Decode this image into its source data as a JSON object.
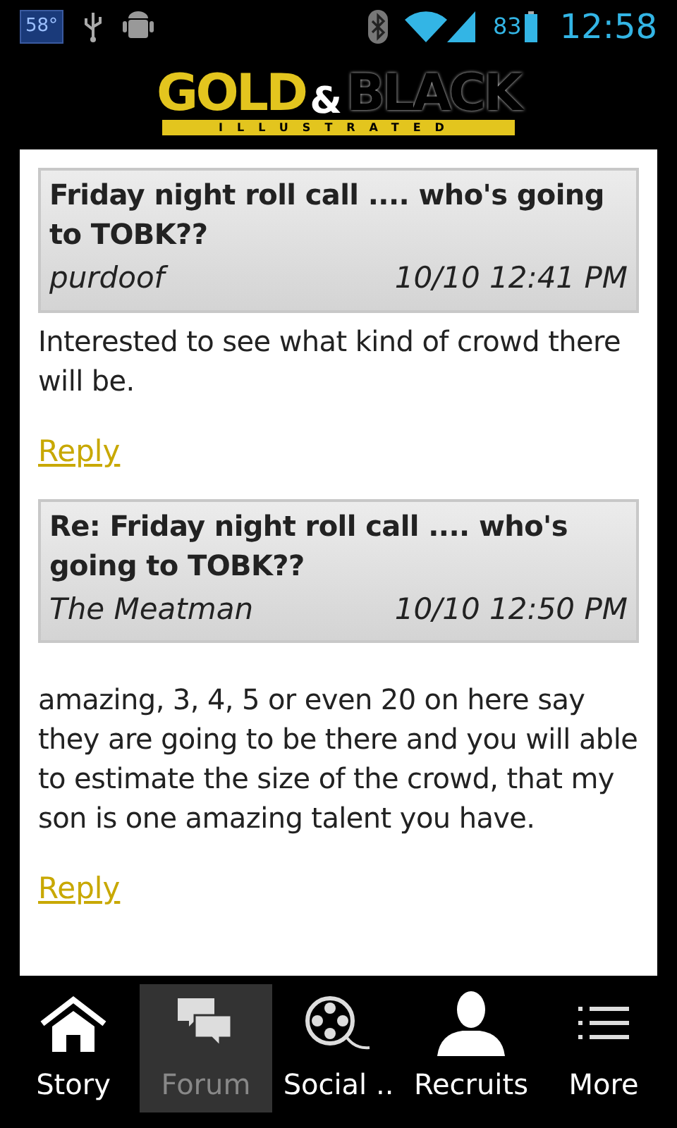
{
  "status_bar": {
    "temperature": "58°",
    "battery": "83",
    "time": "12:58"
  },
  "logo": {
    "title_left": "GOLD",
    "ampersand": "&",
    "title_right": "BLACK",
    "subtitle": "ILLUSTRATED"
  },
  "posts": [
    {
      "title": "Friday night roll call .... who's going to TOBK??",
      "author": "purdoof",
      "date": "10/10 12:41 PM",
      "body": "Interested to see what kind of crowd there will be.",
      "reply": "Reply"
    },
    {
      "title": "Re: Friday night roll call .... who's going to TOBK??",
      "author": "The Meatman",
      "date": "10/10 12:50 PM",
      "body": "amazing, 3, 4, 5 or even 20 on here say they are going to be there and you will able to estimate the size of the crowd, that my son is one amazing talent you have.",
      "reply": "Reply"
    }
  ],
  "tabs": [
    {
      "label": "Story",
      "kind": "home",
      "selected": false
    },
    {
      "label": "Forum",
      "kind": "chat",
      "selected": true
    },
    {
      "label": "Social ..",
      "kind": "film",
      "selected": false
    },
    {
      "label": "Recruits",
      "kind": "person",
      "selected": false
    },
    {
      "label": "More",
      "kind": "list",
      "selected": false
    }
  ]
}
